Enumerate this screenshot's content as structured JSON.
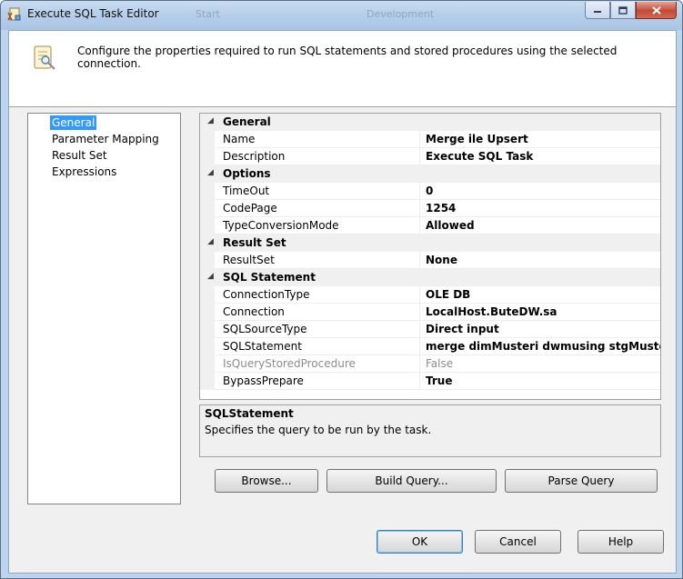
{
  "window": {
    "title": "Execute SQL Task Editor",
    "ghost_left": "Start",
    "ghost_right": "Development"
  },
  "header": {
    "description": "Configure the properties required to run SQL statements and stored procedures using the selected connection."
  },
  "nav": {
    "items": [
      {
        "label": "General",
        "selected": true
      },
      {
        "label": "Parameter Mapping",
        "selected": false
      },
      {
        "label": "Result Set",
        "selected": false
      },
      {
        "label": "Expressions",
        "selected": false
      }
    ]
  },
  "properties": {
    "general": {
      "category": "General",
      "name": {
        "label": "Name",
        "value": "Merge ile Upsert"
      },
      "description": {
        "label": "Description",
        "value": "Execute SQL Task"
      }
    },
    "options": {
      "category": "Options",
      "timeout": {
        "label": "TimeOut",
        "value": "0"
      },
      "codepage": {
        "label": "CodePage",
        "value": "1254"
      },
      "typeconversionmode": {
        "label": "TypeConversionMode",
        "value": "Allowed"
      }
    },
    "result_set": {
      "category": "Result Set",
      "resultset": {
        "label": "ResultSet",
        "value": "None"
      }
    },
    "sql_statement": {
      "category": "SQL Statement",
      "connectiontype": {
        "label": "ConnectionType",
        "value": "OLE DB"
      },
      "connection": {
        "label": "Connection",
        "value": "LocalHost.ButeDW.sa"
      },
      "sqlsourcetype": {
        "label": "SQLSourceType",
        "value": "Direct input"
      },
      "sqlstatement": {
        "label": "SQLStatement",
        "value": "merge dimMusteri dwmusing stgMusteri km o"
      },
      "isquerystoredprocedure": {
        "label": "IsQueryStoredProcedure",
        "value": "False"
      },
      "bypassprepare": {
        "label": "BypassPrepare",
        "value": "True"
      }
    }
  },
  "description_panel": {
    "title": "SQLStatement",
    "text": "Specifies the query to be run by the task."
  },
  "buttons": {
    "browse": "Browse...",
    "build_query": "Build Query...",
    "parse_query": "Parse Query",
    "ok": "OK",
    "cancel": "Cancel",
    "help": "Help"
  },
  "colors": {
    "selection": "#3399ff",
    "titlebar": "#b7cfea",
    "close_button": "#c24a36",
    "dialog_background": "#f0f0f0"
  }
}
